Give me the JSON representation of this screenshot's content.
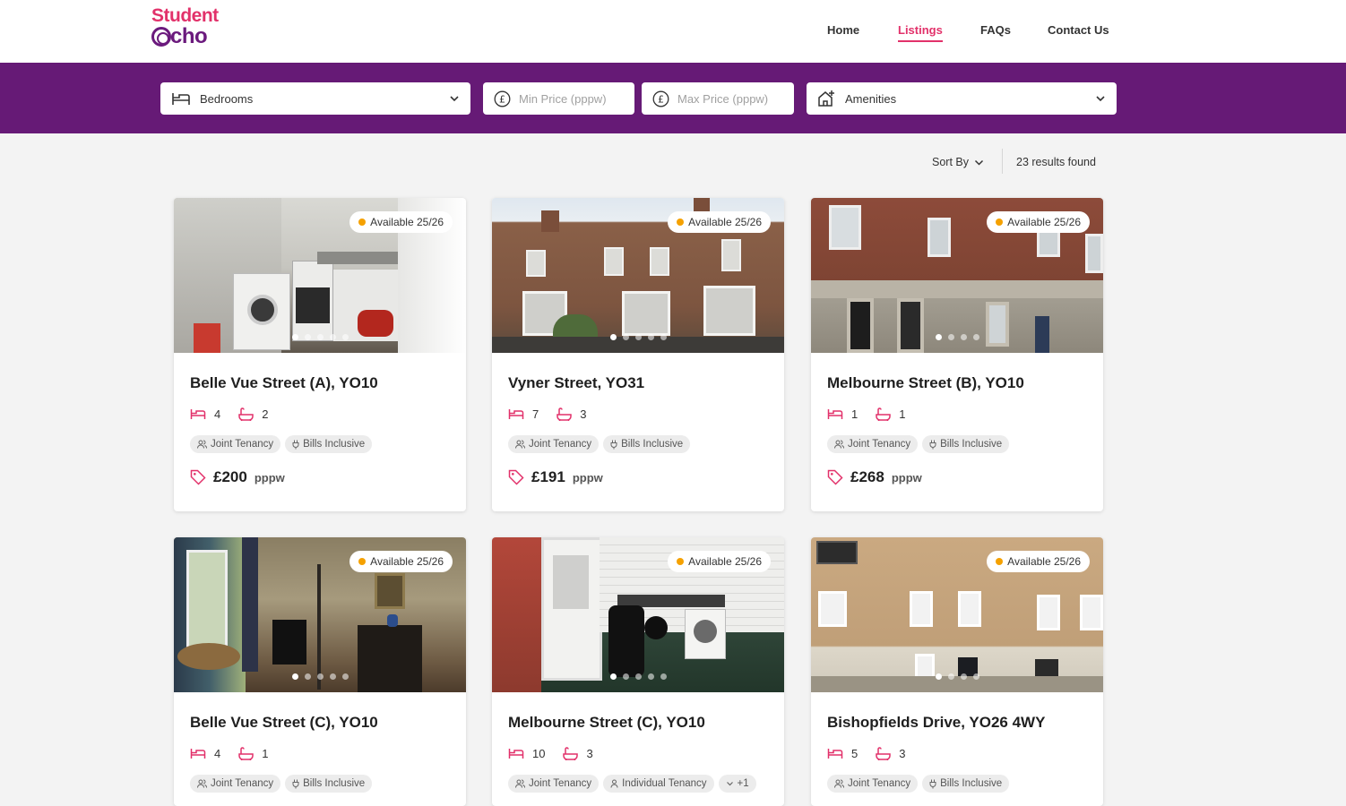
{
  "brand": {
    "line1": "Student",
    "line2": "cho"
  },
  "nav": [
    {
      "label": "Home"
    },
    {
      "label": "Listings"
    },
    {
      "label": "FAQs"
    },
    {
      "label": "Contact Us"
    }
  ],
  "filters": {
    "bedrooms": "Bedrooms",
    "min_price": "Min Price (pppw)",
    "max_price": "Max Price (pppw)",
    "amenities": "Amenities"
  },
  "results": {
    "sort_label": "Sort By",
    "count_text": "23 results found"
  },
  "colors": {
    "brand_pink": "#e2316a",
    "brand_purple": "#661a76",
    "available_dot": "#f5a100"
  },
  "listings": [
    {
      "title": "Belle Vue Street (A), YO10",
      "availability": "Available 25/26",
      "beds": "4",
      "baths": "2",
      "tags": [
        "Joint Tenancy",
        "Bills Inclusive"
      ],
      "price": "£200",
      "unit": "pppw"
    },
    {
      "title": "Vyner Street, YO31",
      "availability": "Available 25/26",
      "beds": "7",
      "baths": "3",
      "tags": [
        "Joint Tenancy",
        "Bills Inclusive"
      ],
      "price": "£191",
      "unit": "pppw"
    },
    {
      "title": "Melbourne Street (B), YO10",
      "availability": "Available 25/26",
      "beds": "1",
      "baths": "1",
      "tags": [
        "Joint Tenancy",
        "Bills Inclusive"
      ],
      "price": "£268",
      "unit": "pppw"
    },
    {
      "title": "Belle Vue Street (C), YO10",
      "availability": "Available 25/26",
      "beds": "4",
      "baths": "1",
      "tags": [
        "Joint Tenancy",
        "Bills Inclusive"
      ]
    },
    {
      "title": "Melbourne Street (C), YO10",
      "availability": "Available 25/26",
      "beds": "10",
      "baths": "3",
      "tags": [
        "Joint Tenancy",
        "Individual Tenancy",
        "+1"
      ]
    },
    {
      "title": "Bishopfields Drive, YO26 4WY",
      "availability": "Available 25/26",
      "beds": "5",
      "baths": "3",
      "tags": [
        "Joint Tenancy",
        "Bills Inclusive"
      ]
    }
  ]
}
